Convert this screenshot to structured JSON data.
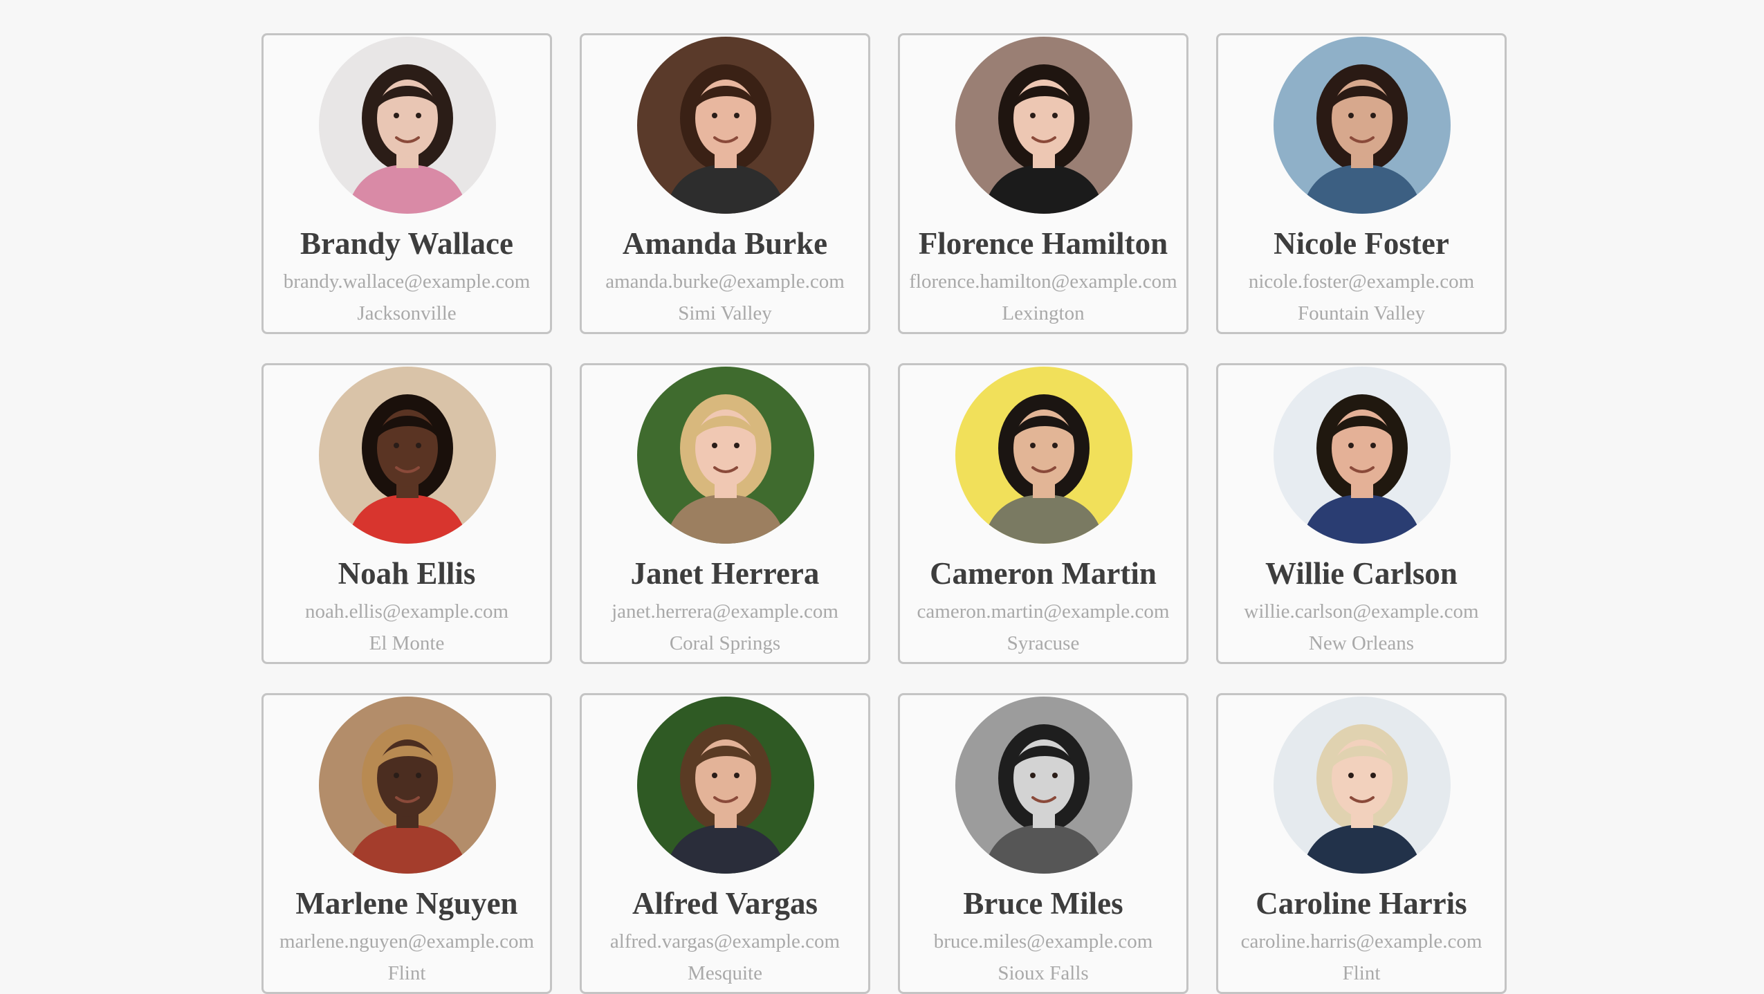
{
  "users": [
    {
      "name": "Brandy Wallace",
      "email": "brandy.wallace@example.com",
      "city": "Jacksonville",
      "bg": "#e8e6e6",
      "skin": "#e9c6b4",
      "hair": "#2b1d17",
      "shirt": "#d98aa6",
      "avatar_icon": "woman-portrait-icon"
    },
    {
      "name": "Amanda Burke",
      "email": "amanda.burke@example.com",
      "city": "Simi Valley",
      "bg": "#5a3a2a",
      "skin": "#e8b79f",
      "hair": "#3a2115",
      "shirt": "#2d2d2d",
      "avatar_icon": "woman-portrait-icon"
    },
    {
      "name": "Florence Hamilton",
      "email": "florence.hamilton@example.com",
      "city": "Lexington",
      "bg": "#9a7f74",
      "skin": "#edc7b3",
      "hair": "#1f1510",
      "shirt": "#1b1b1b",
      "avatar_icon": "woman-portrait-icon"
    },
    {
      "name": "Nicole Foster",
      "email": "nicole.foster@example.com",
      "city": "Fountain Valley",
      "bg": "#8fb0c8",
      "skin": "#d7a88d",
      "hair": "#2a1a14",
      "shirt": "#3c5f82",
      "avatar_icon": "woman-portrait-icon"
    },
    {
      "name": "Noah Ellis",
      "email": "noah.ellis@example.com",
      "city": "El Monte",
      "bg": "#d9c3a8",
      "skin": "#5a3423",
      "hair": "#1a100b",
      "shirt": "#d8352e",
      "avatar_icon": "man-portrait-icon"
    },
    {
      "name": "Janet Herrera",
      "email": "janet.herrera@example.com",
      "city": "Coral Springs",
      "bg": "#3f6b2e",
      "skin": "#f0c8b3",
      "hair": "#d8b87d",
      "shirt": "#9c7f60",
      "avatar_icon": "woman-portrait-icon"
    },
    {
      "name": "Cameron Martin",
      "email": "cameron.martin@example.com",
      "city": "Syracuse",
      "bg": "#f1e05a",
      "skin": "#e2b596",
      "hair": "#1b1512",
      "shirt": "#7a7a62",
      "avatar_icon": "man-portrait-icon"
    },
    {
      "name": "Willie Carlson",
      "email": "willie.carlson@example.com",
      "city": "New Orleans",
      "bg": "#e7ecf1",
      "skin": "#e4b197",
      "hair": "#20180f",
      "shirt": "#2a3d72",
      "avatar_icon": "man-portrait-icon"
    },
    {
      "name": "Marlene Nguyen",
      "email": "marlene.nguyen@example.com",
      "city": "Flint",
      "bg": "#b38d6a",
      "skin": "#4b2d20",
      "hair": "#b88a52",
      "shirt": "#a43d2c",
      "avatar_icon": "woman-portrait-icon"
    },
    {
      "name": "Alfred Vargas",
      "email": "alfred.vargas@example.com",
      "city": "Mesquite",
      "bg": "#2f5a24",
      "skin": "#e3b398",
      "hair": "#5a3b24",
      "shirt": "#2a2d3a",
      "avatar_icon": "man-portrait-icon"
    },
    {
      "name": "Bruce Miles",
      "email": "bruce.miles@example.com",
      "city": "Sioux Falls",
      "bg": "#9c9c9c",
      "skin": "#d3d3d3",
      "hair": "#1e1e1e",
      "shirt": "#565656",
      "avatar_icon": "man-portrait-icon"
    },
    {
      "name": "Caroline Harris",
      "email": "caroline.harris@example.com",
      "city": "Flint",
      "bg": "#e5eaee",
      "skin": "#f2d1bd",
      "hair": "#e0d2b0",
      "shirt": "#22324a",
      "avatar_icon": "woman-portrait-icon"
    }
  ]
}
